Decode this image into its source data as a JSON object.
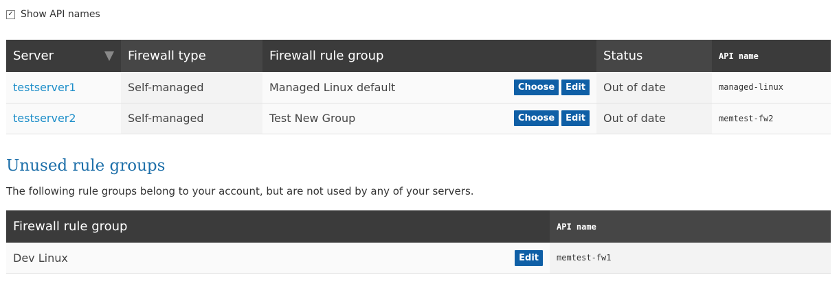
{
  "options": {
    "show_api_names_label": "Show API names",
    "show_api_names_checked": true
  },
  "servers_table": {
    "headers": {
      "server": "Server",
      "firewall_type": "Firewall type",
      "rule_group": "Firewall rule group",
      "status": "Status",
      "api_name": "API name"
    },
    "sort_indicator": "sort-descending-icon",
    "rows": [
      {
        "server": "testserver1",
        "firewall_type": "Self-managed",
        "rule_group": "Managed Linux default",
        "choose_label": "Choose",
        "edit_label": "Edit",
        "status": "Out of date",
        "api_name": "managed-linux"
      },
      {
        "server": "testserver2",
        "firewall_type": "Self-managed",
        "rule_group": "Test New Group",
        "choose_label": "Choose",
        "edit_label": "Edit",
        "status": "Out of date",
        "api_name": "memtest-fw2"
      }
    ]
  },
  "unused_section": {
    "title": "Unused rule groups",
    "description": "The following rule groups belong to your account, but are not used by any of your servers.",
    "headers": {
      "rule_group": "Firewall rule group",
      "api_name": "API name"
    },
    "rows": [
      {
        "rule_group": "Dev Linux",
        "edit_label": "Edit",
        "api_name": "memtest-fw1"
      }
    ]
  },
  "colors": {
    "header_bg": "#3b3b3b",
    "header_bg_alt": "#464646",
    "link": "#1d8ec9",
    "button": "#0f5fa6",
    "section_title": "#1d6fa9"
  }
}
